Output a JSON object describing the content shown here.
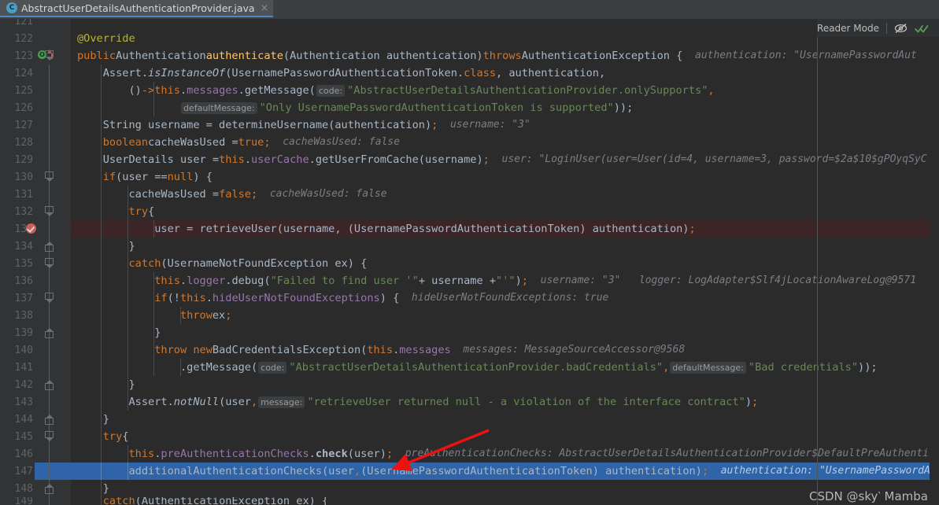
{
  "window": {
    "title": "AbstractUserDetailsAuthenticationProvider.java"
  },
  "tab": {
    "label": "AbstractUserDetailsAuthenticationProvider.java",
    "icon": "java-class-icon",
    "icon_glyph": "C",
    "close_glyph": "×"
  },
  "header": {
    "reader_mode_label": "Reader Mode",
    "eye_off_icon": "eye-crossed-icon",
    "inspection_ok_icon": "double-check-icon",
    "accent_color": "#4a88c7",
    "ok_color": "#499c54"
  },
  "watermark": {
    "text": "CSDN @sky‵ Mamba"
  },
  "editor": {
    "first_line": 121,
    "highlight_execution_line": 147,
    "breakpoint_line": 133,
    "breakpoint_color": "#d05b5b",
    "selection_color": "#2f65a8",
    "breakpoint_row_color": "#3b2526",
    "background": "#2b2b2b",
    "gutter_background": "#313335",
    "lines": [
      {
        "n": 121,
        "text": ""
      },
      {
        "n": 122,
        "text": "@Override"
      },
      {
        "n": 123,
        "text": "public Authentication authenticate(Authentication authentication) throws AuthenticationException {",
        "hint": "authentication:",
        "value": "\"UsernamePasswordAut"
      },
      {
        "n": 124,
        "text": "Assert.isInstanceOf(UsernamePasswordAuthenticationToken.class, authentication,"
      },
      {
        "n": 125,
        "text": "() -> this.messages.getMessage( code: \"AbstractUserDetailsAuthenticationProvider.onlySupports\","
      },
      {
        "n": 126,
        "text": "defaultMessage: \"Only UsernamePasswordAuthenticationToken is supported\"));"
      },
      {
        "n": 127,
        "text": "String username = determineUsername(authentication);",
        "hint": "username:",
        "value": "\"3\""
      },
      {
        "n": 128,
        "text": "boolean cacheWasUsed = true;",
        "hint": "cacheWasUsed:",
        "value": "false"
      },
      {
        "n": 129,
        "text": "UserDetails user = this.userCache.getUserFromCache(username);",
        "hint": "user:",
        "value": "\"LoginUser(user=User(id=4, username=3, password=$2a$10$gPOyqSyC"
      },
      {
        "n": 130,
        "text": "if (user == null) {"
      },
      {
        "n": 131,
        "text": "cacheWasUsed = false;",
        "hint": "cacheWasUsed:",
        "value": "false"
      },
      {
        "n": 132,
        "text": "try {"
      },
      {
        "n": 133,
        "text": "user = retrieveUser(username, (UsernamePasswordAuthenticationToken) authentication);"
      },
      {
        "n": 134,
        "text": "}"
      },
      {
        "n": 135,
        "text": "catch (UsernameNotFoundException ex) {"
      },
      {
        "n": 136,
        "text": "this.logger.debug(\"Failed to find user '\" + username + \"'\");",
        "hint": "username:",
        "value": "\"3\"",
        "hint2": "logger:",
        "value2": "LogAdapter$Slf4jLocationAwareLog@9571"
      },
      {
        "n": 137,
        "text": "if (!this.hideUserNotFoundExceptions) {",
        "hint": "hideUserNotFoundExceptions:",
        "value": "true"
      },
      {
        "n": 138,
        "text": "throw ex;"
      },
      {
        "n": 139,
        "text": "}"
      },
      {
        "n": 140,
        "text": "throw new BadCredentialsException(this.messages",
        "hint": "messages:",
        "value": "MessageSourceAccessor@9568"
      },
      {
        "n": 141,
        "text": ".getMessage( code: \"AbstractUserDetailsAuthenticationProvider.badCredentials\", defaultMessage: \"Bad credentials\"));"
      },
      {
        "n": 142,
        "text": "}"
      },
      {
        "n": 143,
        "text": "Assert.notNull(user, message: \"retrieveUser returned null - a violation of the interface contract\");"
      },
      {
        "n": 144,
        "text": "}"
      },
      {
        "n": 145,
        "text": "try {"
      },
      {
        "n": 146,
        "text": "this.preAuthenticationChecks.check(user);",
        "hint": "preAuthenticationChecks:",
        "value": "AbstractUserDetailsAuthenticationProvider$DefaultPreAuthenti"
      },
      {
        "n": 147,
        "text": "additionalAuthenticationChecks(user, (UsernamePasswordAuthenticationToken) authentication);",
        "hint": "authentication:",
        "value": "\"UsernamePasswordAu"
      },
      {
        "n": 148,
        "text": "}"
      },
      {
        "n": 149,
        "text": "catch (AuthenticationException ex) {"
      }
    ],
    "parameter_hints": {
      "code": "code:",
      "default_message": "defaultMessage:",
      "message": "message:"
    }
  },
  "annotation": {
    "arrow": "red-arrow",
    "arrow_color": "#ee1111"
  }
}
